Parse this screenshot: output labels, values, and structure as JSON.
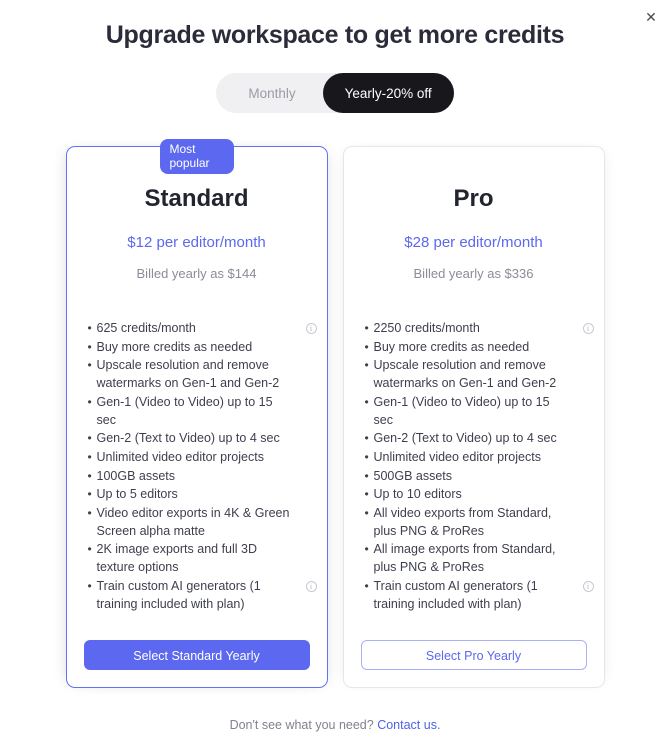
{
  "modal": {
    "title": "Upgrade workspace to get more credits",
    "close_icon": "close-icon",
    "close_glyph": "✕"
  },
  "billing_toggle": {
    "monthly_label": "Monthly",
    "yearly_label": "Yearly-20% off",
    "selected": "Yearly-20% off",
    "active_bg": "#17171c",
    "track_bg": "#f0f0f3"
  },
  "plans": [
    {
      "id": "standard",
      "badge": "Most popular",
      "name": "Standard",
      "price": "$12 per editor/month",
      "billed": "Billed yearly as $144",
      "accent": "#5b68ef",
      "cta": "Select Standard Yearly",
      "features": [
        {
          "text": "625 credits/month",
          "info": true
        },
        {
          "text": "Buy more credits as needed",
          "info": false
        },
        {
          "text": "Upscale resolution and remove watermarks on Gen-1 and Gen-2",
          "info": false
        },
        {
          "text": "Gen-1 (Video to Video) up to 15 sec",
          "info": false
        },
        {
          "text": "Gen-2 (Text to Video) up to 4 sec",
          "info": false
        },
        {
          "text": "Unlimited video editor projects",
          "info": false
        },
        {
          "text": "100GB assets",
          "info": false
        },
        {
          "text": "Up to 5 editors",
          "info": false
        },
        {
          "text": "Video editor exports in 4K & Green Screen alpha matte",
          "info": false
        },
        {
          "text": "2K image exports and full 3D texture options",
          "info": false
        },
        {
          "text": "Train custom AI generators (1 training included with plan)",
          "info": true
        }
      ]
    },
    {
      "id": "pro",
      "badge": null,
      "name": "Pro",
      "price": "$28 per editor/month",
      "billed": "Billed yearly as $336",
      "accent": "#5b68ef",
      "cta": "Select Pro Yearly",
      "features": [
        {
          "text": "2250 credits/month",
          "info": true
        },
        {
          "text": "Buy more credits as needed",
          "info": false
        },
        {
          "text": "Upscale resolution and remove watermarks on Gen-1 and Gen-2",
          "info": false
        },
        {
          "text": "Gen-1 (Video to Video) up to 15 sec",
          "info": false
        },
        {
          "text": "Gen-2 (Text to Video) up to 4 sec",
          "info": false
        },
        {
          "text": "Unlimited video editor projects",
          "info": false
        },
        {
          "text": "500GB assets",
          "info": false
        },
        {
          "text": "Up to 10 editors",
          "info": false
        },
        {
          "text": "All video exports from Standard, plus PNG & ProRes",
          "info": false
        },
        {
          "text": "All image exports from Standard, plus PNG & ProRes",
          "info": false
        },
        {
          "text": "Train custom AI generators (1 training included with plan)",
          "info": true
        }
      ]
    }
  ],
  "footer": {
    "text": "Don't see what you need?",
    "link": "Contact us."
  },
  "icons": {
    "info_glyph": "i",
    "bullet_glyph": "•"
  }
}
